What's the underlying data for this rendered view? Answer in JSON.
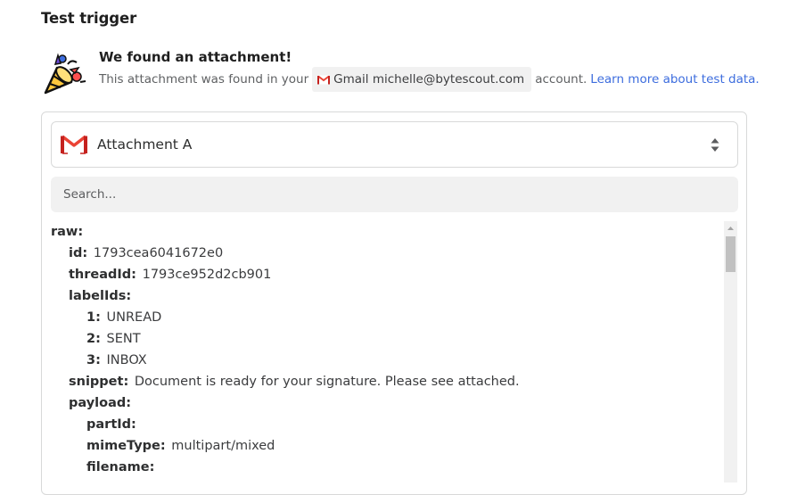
{
  "page_title": "Test trigger",
  "result": {
    "heading": "We found an attachment!",
    "text_before": "This attachment was found in your",
    "account_chip": "Gmail michelle@bytescout.com",
    "text_after": "account.",
    "learn_more_link": "Learn more about test data."
  },
  "selector": {
    "label": "Attachment A"
  },
  "search": {
    "placeholder": "Search..."
  },
  "tree": [
    {
      "key": "raw:",
      "value": "",
      "indent": 0
    },
    {
      "key": "id:",
      "value": "1793cea6041672e0",
      "indent": 1
    },
    {
      "key": "threadId:",
      "value": "1793ce952d2cb901",
      "indent": 1
    },
    {
      "key": "labelIds:",
      "value": "",
      "indent": 1
    },
    {
      "key": "1:",
      "value": "UNREAD",
      "indent": 2
    },
    {
      "key": "2:",
      "value": "SENT",
      "indent": 2
    },
    {
      "key": "3:",
      "value": "INBOX",
      "indent": 2
    },
    {
      "key": "snippet:",
      "value": "Document is ready for your signature. Please see attached.",
      "indent": 1
    },
    {
      "key": "payload:",
      "value": "",
      "indent": 1
    },
    {
      "key": "partId:",
      "value": "",
      "indent": 2
    },
    {
      "key": "mimeType:",
      "value": "multipart/mixed",
      "indent": 2
    },
    {
      "key": "filename:",
      "value": "",
      "indent": 2
    }
  ],
  "colors": {
    "link": "#3d6dde",
    "gmail_red": "#ea4335"
  },
  "icons": {
    "celebration": "party-popper-icon",
    "gmail": "gmail-icon",
    "sort": "sort-arrows-icon"
  }
}
